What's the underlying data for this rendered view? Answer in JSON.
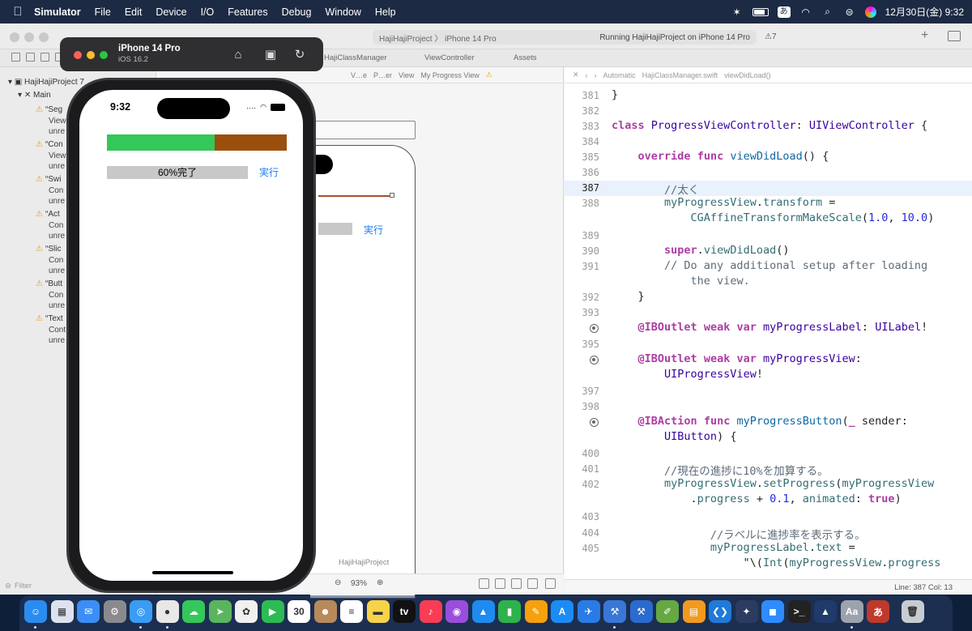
{
  "menubar": {
    "app": "Simulator",
    "menus": [
      "File",
      "Edit",
      "Device",
      "I/O",
      "Features",
      "Debug",
      "Window",
      "Help"
    ],
    "ime": "あ",
    "datetime": "12月30日(金) 9:32"
  },
  "xcode": {
    "scheme": "HajiHajiProject 〉 iPhone 14 Pro",
    "run_status": "Running HajiHajiProject on iPhone 14 Pro",
    "warning_count": "7",
    "tabs": [
      "HajiClassManager",
      "ViewController",
      "Assets"
    ],
    "project_title": "HajiHajiProject",
    "navigator": {
      "project": "HajiHajiProject 7",
      "group": "Main",
      "warnings": [
        {
          "title": "“Seg",
          "lines": [
            "View",
            "unre"
          ]
        },
        {
          "title": "“Con",
          "lines": [
            "View",
            "unre"
          ]
        },
        {
          "title": "“Swi",
          "lines": [
            "Con",
            "unre"
          ]
        },
        {
          "title": "“Act",
          "lines": [
            "Con",
            "unre"
          ]
        },
        {
          "title": "“Slic",
          "lines": [
            "Con",
            "unre"
          ]
        },
        {
          "title": "“Butt",
          "lines": [
            "Con",
            "unre"
          ]
        },
        {
          "title": "“Text",
          "lines": [
            "Cont",
            "unre"
          ]
        }
      ],
      "filter_placeholder": "Filter"
    },
    "canvas": {
      "breadcrumb": [
        "V…e",
        "P…er",
        "View",
        "My Progress View"
      ],
      "exec_label": "実行",
      "zoom": "93%"
    },
    "editor": {
      "breadcrumb": [
        "Automatic",
        "HajiClassManager.swift",
        "viewDidLoad()"
      ],
      "cursor": "Line: 387  Col: 13",
      "lines": [
        {
          "n": "381",
          "html": "}"
        },
        {
          "n": "382",
          "html": ""
        },
        {
          "n": "383",
          "html": "<span class='kw'>class</span> <span class='ty'>ProgressViewController</span>: <span class='ty'>UIViewController</span> {"
        },
        {
          "n": "384",
          "html": ""
        },
        {
          "n": "385",
          "html": "    <span class='kw'>override</span> <span class='kw'>func</span> <span class='fn'>viewDidLoad</span>() {"
        },
        {
          "n": "386",
          "html": ""
        },
        {
          "n": "387",
          "html": "        <span class='cm'>//太く</span>",
          "current": true
        },
        {
          "n": "388",
          "html": "        <span class='pl'>myProgressView</span>.<span class='pl'>transform</span> ="
        },
        {
          "n": "",
          "html": "            <span class='pl'>CGAffineTransformMakeScale</span>(<span class='num'>1.0</span>, <span class='num'>10.0</span>)"
        },
        {
          "n": "389",
          "html": ""
        },
        {
          "n": "390",
          "html": "        <span class='kw'>super</span>.<span class='pl'>viewDidLoad</span>()"
        },
        {
          "n": "391",
          "html": "        <span class='cm'>// Do any additional setup after loading</span>"
        },
        {
          "n": "",
          "html": "            <span class='cm'>the view.</span>"
        },
        {
          "n": "392",
          "html": "    }"
        },
        {
          "n": "393",
          "html": ""
        },
        {
          "n": "",
          "html": "    <span class='at'>@IBOutlet</span> <span class='kw'>weak</span> <span class='kw'>var</span> <span class='ty'>myProgressLabel</span>: <span class='ty'>UILabel</span>!",
          "bp": true
        },
        {
          "n": "395",
          "html": ""
        },
        {
          "n": "",
          "html": "    <span class='at'>@IBOutlet</span> <span class='kw'>weak</span> <span class='kw'>var</span> <span class='ty'>myProgressView</span>:",
          "bp": true
        },
        {
          "n": "",
          "html": "        <span class='ty'>UIProgressView</span>!"
        },
        {
          "n": "397",
          "html": ""
        },
        {
          "n": "398",
          "html": ""
        },
        {
          "n": "",
          "html": "    <span class='at'>@IBAction</span> <span class='kw'>func</span> <span class='fn'>myProgressButton</span>(<span class='kw'>_</span> sender:",
          "bp": true
        },
        {
          "n": "",
          "html": "        <span class='ty'>UIButton</span>) {"
        },
        {
          "n": "400",
          "html": ""
        },
        {
          "n": "401",
          "html": "        <span class='cm'>//現在の進捗に10%を加算する。</span>"
        },
        {
          "n": "402",
          "html": "        <span class='pl'>myProgressView</span>.<span class='pl'>setProgress</span>(<span class='pl'>myProgressView</span>"
        },
        {
          "n": "",
          "html": "            .<span class='pl'>progress</span> + <span class='num'>0.1</span>, <span class='pl'>animated</span>: <span class='kw'>true</span>)"
        },
        {
          "n": "403",
          "html": ""
        },
        {
          "n": "404",
          "html": "               <span class='cm'>//ラベルに進捗率を表示する。</span>"
        },
        {
          "n": "405",
          "html": "               <span class='pl'>myProgressLabel</span>.<span class='pl'>text</span> ="
        },
        {
          "n": "",
          "html": "                    \"\\(<span class='pl'>Int</span>(<span class='pl'>myProgressView</span>.<span class='pl'>progress</span>"
        }
      ]
    }
  },
  "simulator": {
    "device": "iPhone 14 Pro",
    "os": "iOS 16.2",
    "time": "9:32",
    "progress": 0.6,
    "progress_label": "60%完了",
    "exec_button": "実行",
    "colors": {
      "track": "#9a4f0c",
      "fill": "#34c759",
      "tint": "#1a7cf5"
    }
  },
  "dock": {
    "apps": [
      {
        "name": "Finder",
        "color": "#2a8cf0",
        "glyph": "☺"
      },
      {
        "name": "Launchpad",
        "color": "#dde3ee",
        "glyph": "▦"
      },
      {
        "name": "Mail",
        "color": "#3a8ef6",
        "glyph": "✉"
      },
      {
        "name": "System Settings",
        "color": "#8a8a8e",
        "glyph": "⚙"
      },
      {
        "name": "Safari",
        "color": "#3a9cf5",
        "glyph": "◎"
      },
      {
        "name": "Chrome",
        "color": "#e8e8e8",
        "glyph": "●"
      },
      {
        "name": "Messages",
        "color": "#34c759",
        "glyph": "☁"
      },
      {
        "name": "Maps",
        "color": "#5ab55e",
        "glyph": "➤"
      },
      {
        "name": "Photos",
        "color": "#f0f0f0",
        "glyph": "✿"
      },
      {
        "name": "FaceTime",
        "color": "#2dbb53",
        "glyph": "▶"
      },
      {
        "name": "Calendar",
        "color": "#ffffff",
        "glyph": "30"
      },
      {
        "name": "Contacts",
        "color": "#b88a5a",
        "glyph": "☻"
      },
      {
        "name": "Reminders",
        "color": "#ffffff",
        "glyph": "≡"
      },
      {
        "name": "Notes",
        "color": "#f7d34a",
        "glyph": "▬"
      },
      {
        "name": "TV",
        "color": "#111111",
        "glyph": "tv"
      },
      {
        "name": "Music",
        "color": "#fa3c55",
        "glyph": "♪"
      },
      {
        "name": "Podcasts",
        "color": "#9a4ddc",
        "glyph": "◉"
      },
      {
        "name": "Keynote",
        "color": "#1e8bf0",
        "glyph": "▲"
      },
      {
        "name": "Numbers",
        "color": "#2fb24c",
        "glyph": "▮"
      },
      {
        "name": "Pages",
        "color": "#f6a00c",
        "glyph": "✎"
      },
      {
        "name": "App Store",
        "color": "#1b8cf5",
        "glyph": "A"
      },
      {
        "name": "Xcode Instruments",
        "color": "#2a7be6",
        "glyph": "✈"
      },
      {
        "name": "Xcode",
        "color": "#3977d6",
        "glyph": "⚒"
      },
      {
        "name": "Xcode Beta",
        "color": "#2a6bd0",
        "glyph": "⚒"
      },
      {
        "name": "Coda",
        "color": "#66a843",
        "glyph": "✐"
      },
      {
        "name": "Books",
        "color": "#f39a1e",
        "glyph": "▤"
      },
      {
        "name": "VS Code",
        "color": "#1f7ad8",
        "glyph": "❮❯"
      },
      {
        "name": "Xcode Cloud",
        "color": "#2c3b60",
        "glyph": "✦"
      },
      {
        "name": "Zoom",
        "color": "#2d8cff",
        "glyph": "◼"
      },
      {
        "name": "Terminal",
        "color": "#222222",
        "glyph": ">_"
      },
      {
        "name": "Affinity",
        "color": "#1f3a6b",
        "glyph": "▲"
      },
      {
        "name": "Font Book",
        "color": "#9da3ad",
        "glyph": "Aa"
      },
      {
        "name": "Kotoeri",
        "color": "#c0392b",
        "glyph": "あ"
      },
      {
        "name": "Trash",
        "color": "#c8ccd2",
        "glyph": "🗑"
      }
    ]
  }
}
